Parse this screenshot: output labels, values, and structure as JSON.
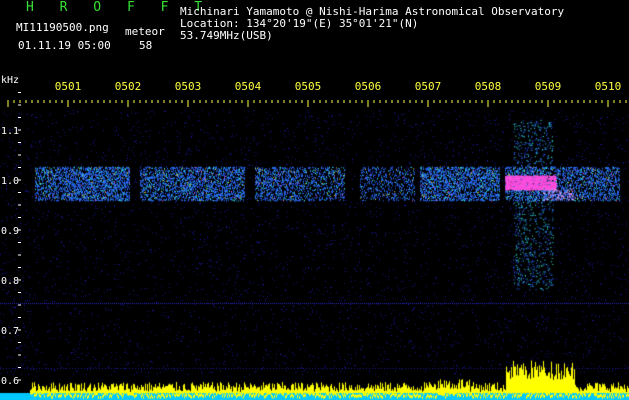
{
  "header": {
    "program": "H R O F F T",
    "filename": "MI11190500.png",
    "counter_label": "meteor",
    "datetime": "01.11.19 05:00",
    "count": "58",
    "observer": "Michinari Yamamoto @ Nishi-Harima Astronomical Observatory",
    "location": "Location: 134°20'19\"(E) 35°01'21\"(N)",
    "frequency": "53.749MHz(USB)"
  },
  "chart_data": {
    "type": "heatmap",
    "ylabel": "kHz",
    "y_ticks": [
      "1.1",
      "1.0",
      "0.9",
      "0.8",
      "0.7",
      "0.6"
    ],
    "y_values": [
      1.1,
      1.0,
      0.9,
      0.8,
      0.7,
      0.6
    ],
    "ylim": [
      0.59,
      1.2
    ],
    "x_ticks": [
      "0501",
      "0502",
      "0503",
      "0504",
      "0505",
      "0506",
      "0507",
      "0508",
      "0509",
      "0510"
    ],
    "x_minutes": [
      1,
      2,
      3,
      4,
      5,
      6,
      7,
      8,
      9,
      10
    ],
    "xlim": [
      0.4,
      10.4
    ],
    "signal_band_khz": 0.993,
    "strong_event_minute": 8.75,
    "colors": {
      "background": "#000000",
      "noise": "#1a1aa8",
      "signal_low": "#2a6cff",
      "signal_mid": "#2ee8d8",
      "signal_high": "#ff4fe0",
      "tick": "#ffff40",
      "power": "#ffff00",
      "power_base": "#00c8ff"
    }
  }
}
